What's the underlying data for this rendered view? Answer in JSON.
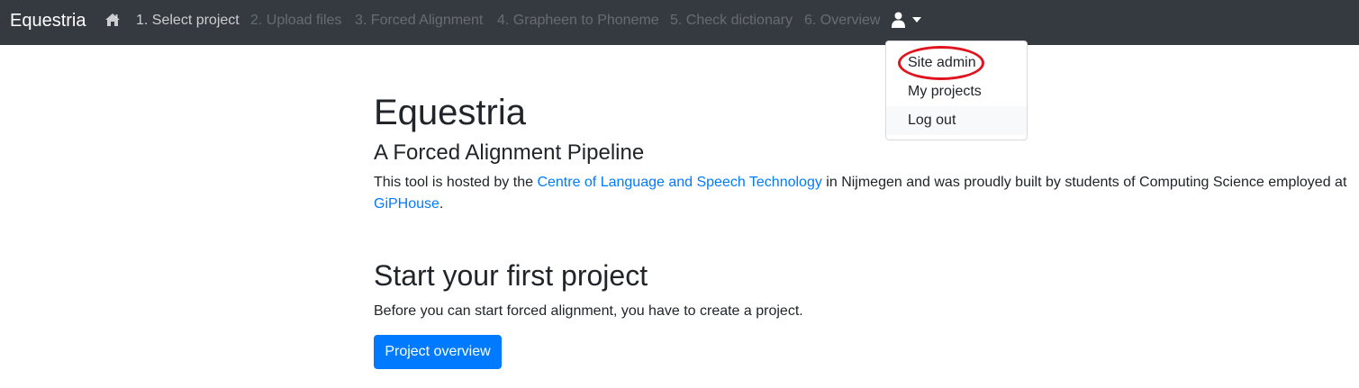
{
  "navbar": {
    "brand": "Equestria",
    "home_icon": "home-icon",
    "items": [
      {
        "label": "1. Select project",
        "state": "active"
      },
      {
        "label": "2. Upload files",
        "state": "disabled"
      },
      {
        "label": "3. Forced Alignment",
        "state": "disabled"
      },
      {
        "label": "4. Grapheen to Phoneme",
        "state": "disabled"
      },
      {
        "label": "5. Check dictionary",
        "state": "disabled"
      },
      {
        "label": "6. Overview",
        "state": "disabled"
      }
    ],
    "user_icon": "user-icon",
    "caret_icon": "caret-down-icon",
    "background_color": "#343a40"
  },
  "user_menu": {
    "items": [
      {
        "label": "Site admin"
      },
      {
        "label": "My projects"
      },
      {
        "label": "Log out"
      }
    ],
    "highlight_color": "#e0141e"
  },
  "main": {
    "title": "Equestria",
    "subtitle": "A Forced Alignment Pipeline",
    "intro": {
      "text_before": "This tool is hosted by the ",
      "link1": "Centre of Language and Speech Technology",
      "text_middle": " in Nijmegen and was proudly built by students of Computing Science employed at ",
      "link2": "GiPHouse",
      "text_after": "."
    },
    "section_title": "Start your first project",
    "section_text": "Before you can start forced alignment, you have to create a project.",
    "button_label": "Project overview",
    "accent_color": "#007bff"
  }
}
